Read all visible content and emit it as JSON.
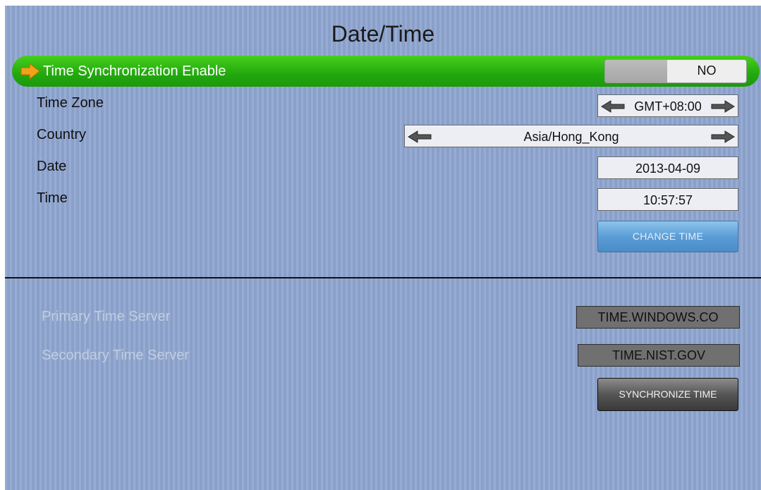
{
  "page": {
    "title": "Date/Time"
  },
  "settings": {
    "sync_enable": {
      "label": "Time Synchronization Enable",
      "value": "NO"
    },
    "time_zone": {
      "label": "Time Zone",
      "value": "GMT+08:00"
    },
    "country": {
      "label": "Country",
      "value": "Asia/Hong_Kong"
    },
    "date": {
      "label": "Date",
      "value": "2013-04-09"
    },
    "time": {
      "label": "Time",
      "value": "10:57:57"
    },
    "change_time_button": "CHANGE TIME"
  },
  "servers": {
    "primary": {
      "label": "Primary Time Server",
      "value": "TIME.WINDOWS.CO"
    },
    "secondary": {
      "label": "Secondary Time Server",
      "value": "TIME.NIST.GOV"
    },
    "sync_button": "SYNCHRONIZE TIME"
  },
  "colors": {
    "background": "#8fa6d0",
    "highlight": "#2fb818",
    "pointer_arrow": "#f2a21a",
    "change_button": "#5b9ed6",
    "sync_button": "#555555",
    "disabled_text": "#c2cde0"
  },
  "icons": {
    "selection_pointer": "arrow-right-icon",
    "decrement": "arrow-left-icon",
    "increment": "arrow-right-icon"
  }
}
